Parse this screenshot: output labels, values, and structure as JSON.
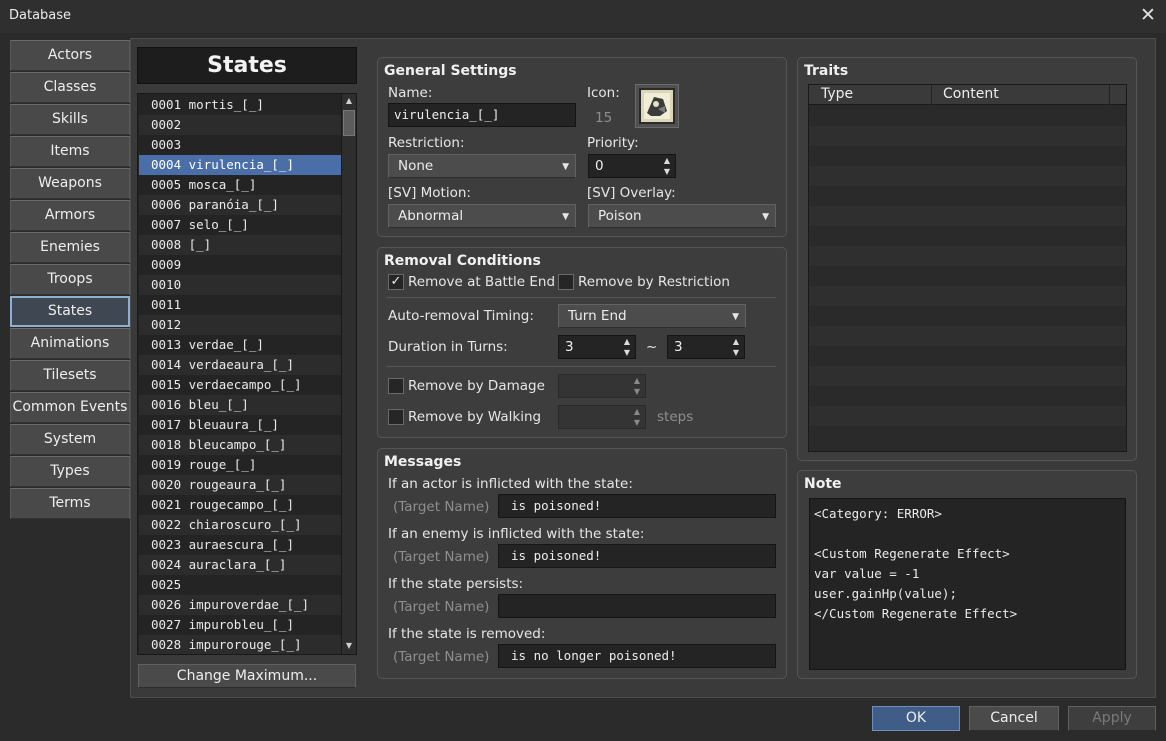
{
  "window": {
    "title": "Database",
    "close_glyph": "✕"
  },
  "nav": [
    {
      "id": "actors",
      "label": "Actors"
    },
    {
      "id": "classes",
      "label": "Classes"
    },
    {
      "id": "skills",
      "label": "Skills"
    },
    {
      "id": "items",
      "label": "Items"
    },
    {
      "id": "weapons",
      "label": "Weapons"
    },
    {
      "id": "armors",
      "label": "Armors"
    },
    {
      "id": "enemies",
      "label": "Enemies"
    },
    {
      "id": "troops",
      "label": "Troops"
    },
    {
      "id": "states",
      "label": "States",
      "selected": true
    },
    {
      "id": "animations",
      "label": "Animations"
    },
    {
      "id": "tilesets",
      "label": "Tilesets"
    },
    {
      "id": "common-events",
      "label": "Common Events"
    },
    {
      "id": "system",
      "label": "System"
    },
    {
      "id": "types",
      "label": "Types"
    },
    {
      "id": "terms",
      "label": "Terms"
    }
  ],
  "states_panel": {
    "header": "States",
    "change_max_label": "Change Maximum...",
    "items": [
      "0001 mortis_[_]",
      "0002",
      "0003",
      "0004 virulencia_[_]",
      "0005 mosca_[_]",
      "0006 paranóia_[_]",
      "0007 selo_[_]",
      "0008 [_]",
      "0009",
      "0010",
      "0011",
      "0012",
      "0013 verdae_[_]",
      "0014 verdaeaura_[_]",
      "0015 verdaecampo_[_]",
      "0016 bleu_[_]",
      "0017 bleuaura_[_]",
      "0018 bleucampo_[_]",
      "0019 rouge_[_]",
      "0020 rougeaura_[_]",
      "0021 rougecampo_[_]",
      "0022 chiaroscuro_[_]",
      "0023 auraescura_[_]",
      "0024 auraclara_[_]",
      "0025",
      "0026 impuroverdae_[_]",
      "0027 impurobleu_[_]",
      "0028 impurorouge_[_]"
    ],
    "selected_index": 3
  },
  "general": {
    "title": "General Settings",
    "name_label": "Name:",
    "name_value": "virulencia_[_]",
    "icon_label": "Icon:",
    "icon_index": "15",
    "restriction_label": "Restriction:",
    "restriction_value": "None",
    "priority_label": "Priority:",
    "priority_value": "0",
    "motion_label": "[SV] Motion:",
    "motion_value": "Abnormal",
    "overlay_label": "[SV] Overlay:",
    "overlay_value": "Poison"
  },
  "removal": {
    "title": "Removal Conditions",
    "battle_end_label": "Remove at Battle End",
    "battle_end_checked": true,
    "restriction_label": "Remove by Restriction",
    "restriction_checked": false,
    "timing_label": "Auto-removal Timing:",
    "timing_value": "Turn End",
    "duration_label": "Duration in Turns:",
    "duration_min": "3",
    "duration_tilde": "~",
    "duration_max": "3",
    "damage_label": "Remove by Damage",
    "damage_checked": false,
    "walking_label": "Remove by Walking",
    "walking_checked": false,
    "steps_label": "steps"
  },
  "messages": {
    "title": "Messages",
    "target_placeholder": "(Target Name)",
    "actor_label": "If an actor is inflicted with the state:",
    "actor_value": "is poisoned!",
    "enemy_label": "If an enemy is inflicted with the state:",
    "enemy_value": "is poisoned!",
    "persist_label": "If the state persists:",
    "persist_value": "",
    "removed_label": "If the state is removed:",
    "removed_value": "is no longer poisoned!"
  },
  "traits": {
    "title": "Traits",
    "col_type": "Type",
    "col_content": "Content"
  },
  "note": {
    "title": "Note",
    "lines": [
      "<Category: ERROR>",
      "",
      "<Custom Regenerate Effect>",
      "var value = -1",
      "user.gainHp(value);",
      "</Custom Regenerate Effect>"
    ]
  },
  "footer": {
    "ok": "OK",
    "cancel": "Cancel",
    "apply": "Apply"
  },
  "colors": {
    "selection": "#4a6ea7",
    "accent_border": "#8eafd4",
    "background": "#2b2b2b"
  },
  "icons": {
    "close": "close-icon",
    "checkbox_mark": "✓",
    "dropdown": "chevron-down-icon",
    "spinner": "spinner-arrows-icon"
  }
}
